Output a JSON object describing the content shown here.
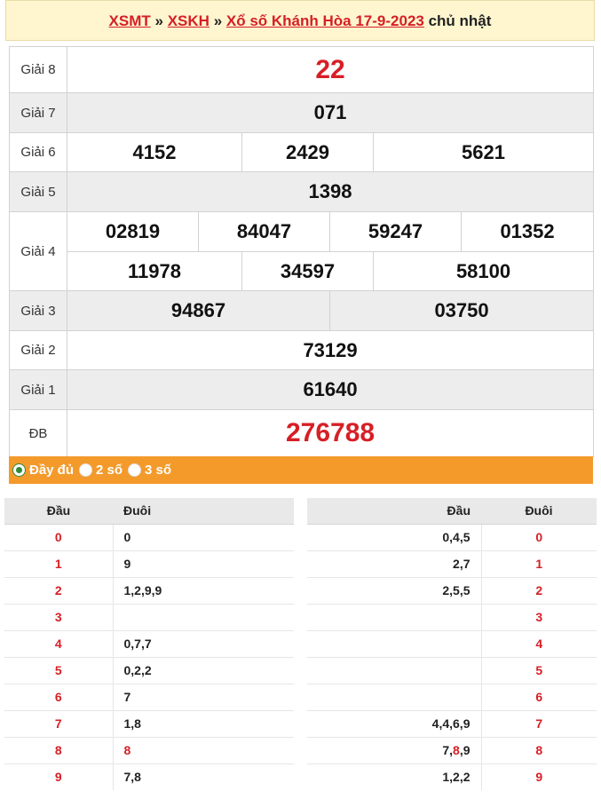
{
  "header": {
    "crumb1": "XSMT",
    "sep1": "»",
    "crumb2": "XSKH",
    "sep2": "»",
    "title": "Xổ số Khánh Hòa 17-9-2023",
    "weekday": "chủ nhật"
  },
  "prizes": {
    "g8": {
      "label": "Giải 8",
      "values": [
        "22"
      ]
    },
    "g7": {
      "label": "Giải 7",
      "values": [
        "071"
      ]
    },
    "g6": {
      "label": "Giải 6",
      "values": [
        "4152",
        "2429",
        "5621"
      ]
    },
    "g5": {
      "label": "Giải 5",
      "values": [
        "1398"
      ]
    },
    "g4": {
      "label": "Giải 4",
      "values": [
        "02819",
        "84047",
        "59247",
        "01352",
        "11978",
        "34597",
        "58100"
      ]
    },
    "g3": {
      "label": "Giải 3",
      "values": [
        "94867",
        "03750"
      ]
    },
    "g2": {
      "label": "Giải 2",
      "values": [
        "73129"
      ]
    },
    "g1": {
      "label": "Giải 1",
      "values": [
        "61640"
      ]
    },
    "db": {
      "label": "ĐB",
      "values": [
        "276788"
      ]
    }
  },
  "options": [
    {
      "label": "Đầy đủ",
      "selected": true
    },
    {
      "label": "2 số",
      "selected": false
    },
    {
      "label": "3 số",
      "selected": false
    }
  ],
  "loto_dau": {
    "head_label": "Đầu",
    "tail_label": "Đuôi",
    "rows": [
      {
        "head": "0",
        "tails": "0"
      },
      {
        "head": "1",
        "tails": "9"
      },
      {
        "head": "2",
        "tails": "1,2,9,9"
      },
      {
        "head": "3",
        "tails": ""
      },
      {
        "head": "4",
        "tails": "0,7,7"
      },
      {
        "head": "5",
        "tails": "0,2,2"
      },
      {
        "head": "6",
        "tails": "7"
      },
      {
        "head": "7",
        "tails": "1,8"
      },
      {
        "head": "8",
        "tails": "8"
      },
      {
        "head": "9",
        "tails": "7,8"
      }
    ]
  },
  "loto_duoi": {
    "head_label": "Đầu",
    "tail_label": "Đuôi",
    "rows": [
      {
        "heads": "0,4,5",
        "tail": "0"
      },
      {
        "heads": "2,7",
        "tail": "1"
      },
      {
        "heads": "2,5,5",
        "tail": "2"
      },
      {
        "heads": "",
        "tail": "3"
      },
      {
        "heads": "",
        "tail": "4"
      },
      {
        "heads": "",
        "tail": "5"
      },
      {
        "heads": "",
        "tail": "6"
      },
      {
        "heads": "4,4,6,9",
        "tail": "7"
      },
      {
        "heads_pre": "7,",
        "heads_hl": "8",
        "heads_post": ",9",
        "tail": "8"
      },
      {
        "heads": "1,2,2",
        "tail": "9"
      }
    ]
  },
  "colors": {
    "accent": "#d61f26",
    "bar": "#f39a2b",
    "header_bg": "#fff6cf",
    "radio_on": "#2e8b3a"
  }
}
